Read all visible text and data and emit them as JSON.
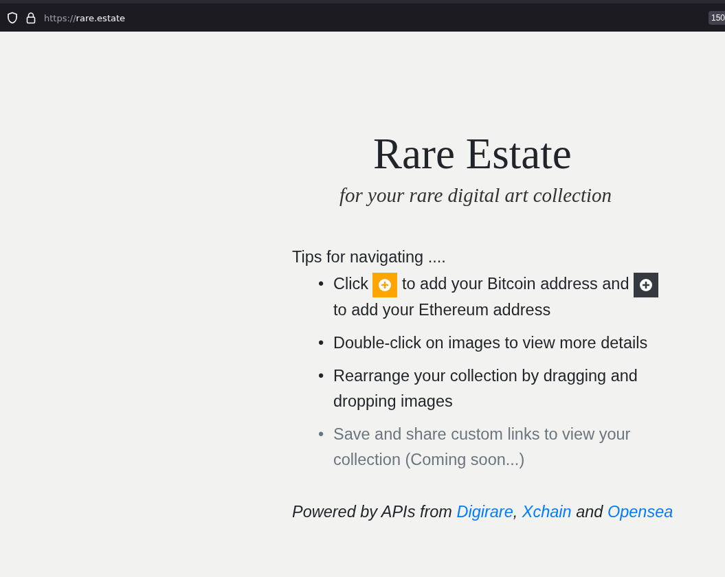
{
  "browser": {
    "url_scheme": "https://",
    "url_host": "rare.estate",
    "zoom": "150"
  },
  "title": "Rare Estate",
  "subtitle": "for your rare digital art collection",
  "tips_heading": "Tips for navigating ....",
  "tips": [
    {
      "marker": "•",
      "disabled": false,
      "parts": [
        {
          "kind": "text",
          "text": "Click"
        },
        {
          "kind": "button",
          "color": "#ffa500"
        },
        {
          "kind": "text",
          "text": "to add your Bitcoin address and"
        },
        {
          "kind": "button",
          "color": "#343a40"
        },
        {
          "kind": "text",
          "text": "to add your Ethereum address"
        }
      ]
    },
    {
      "marker": "•",
      "disabled": false,
      "parts": [
        {
          "kind": "text",
          "text": "Double-click on images to view more details"
        }
      ]
    },
    {
      "marker": "•",
      "disabled": false,
      "parts": [
        {
          "kind": "text",
          "text": "Rearrange your collection by dragging and dropping images"
        }
      ]
    },
    {
      "marker": "•",
      "disabled": true,
      "parts": [
        {
          "kind": "text",
          "text": "Save and share custom links to view your collection (Coming soon...)"
        }
      ]
    }
  ],
  "footer": [
    {
      "kind": "text",
      "text": "Powered by APIs from "
    },
    {
      "kind": "link",
      "text": "Digirare"
    },
    {
      "kind": "text",
      "text": ", "
    },
    {
      "kind": "link",
      "text": "Xchain"
    },
    {
      "kind": "text",
      "text": " and "
    },
    {
      "kind": "link",
      "text": "Opensea"
    }
  ]
}
